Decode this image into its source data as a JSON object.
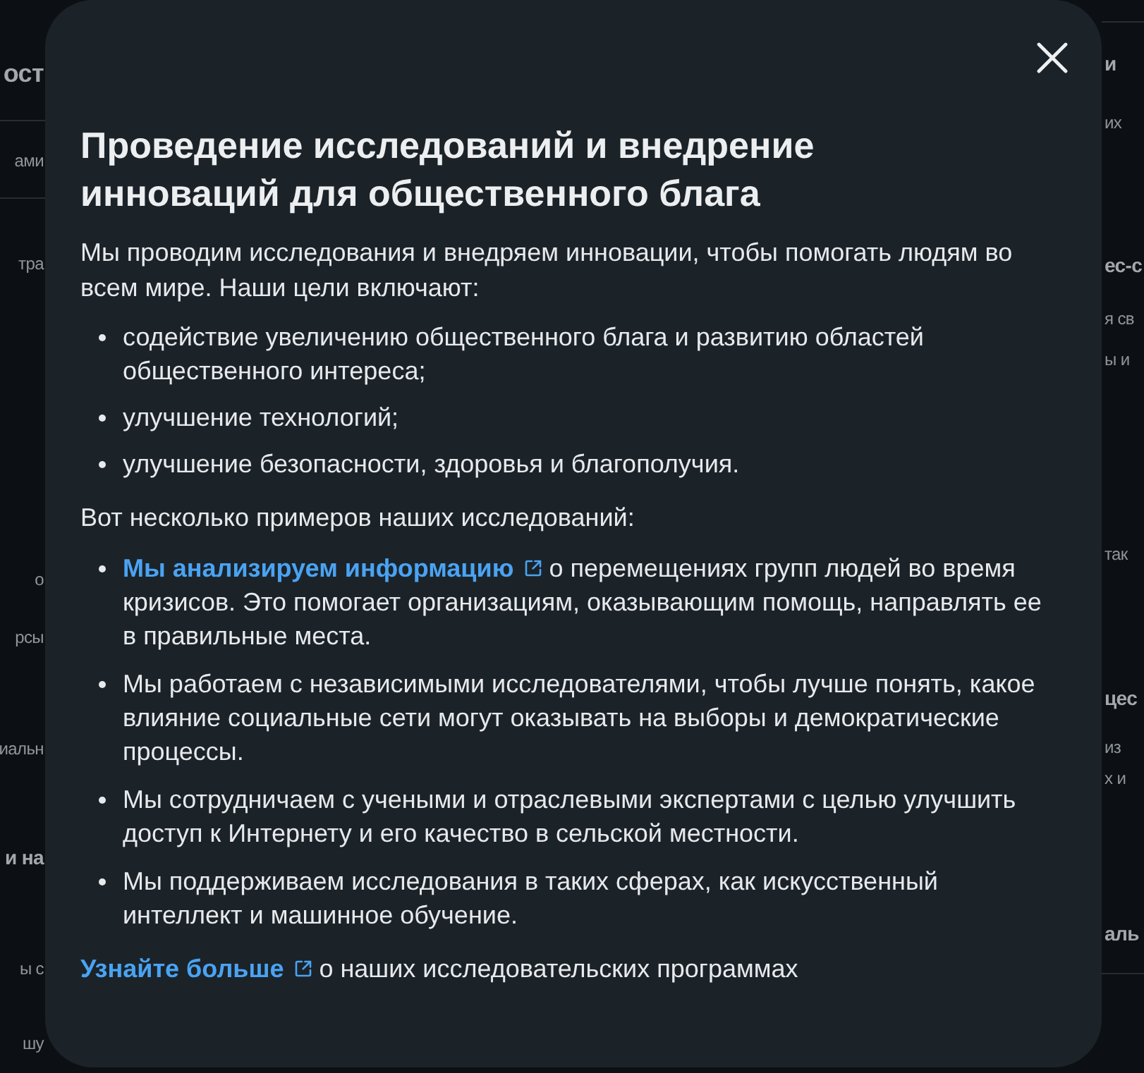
{
  "background": {
    "left_column": [
      {
        "kind": "title",
        "text": "ост"
      },
      {
        "kind": "text",
        "text": "ами"
      },
      {
        "kind": "text",
        "text": "тра"
      },
      {
        "kind": "text",
        "text": "о"
      },
      {
        "kind": "text",
        "text": "рсы"
      },
      {
        "kind": "text",
        "text": "иальн"
      },
      {
        "kind": "heading",
        "text": "и на"
      },
      {
        "kind": "text",
        "text": "ы с"
      },
      {
        "kind": "text",
        "text": "шу"
      }
    ],
    "right_column": [
      {
        "kind": "heading",
        "text": "и"
      },
      {
        "kind": "text",
        "text": "их"
      },
      {
        "kind": "heading",
        "text": "ес-с"
      },
      {
        "kind": "text",
        "text": "я св"
      },
      {
        "kind": "text",
        "text": "ы и"
      },
      {
        "kind": "text",
        "text": "так"
      },
      {
        "kind": "heading",
        "text": "цес"
      },
      {
        "kind": "text",
        "text": "из"
      },
      {
        "kind": "text",
        "text": "х и"
      },
      {
        "kind": "heading",
        "text": "аль"
      }
    ]
  },
  "dialog": {
    "title": "Проведение исследований и внедрение инноваций для общественного блага",
    "intro": "Мы проводим исследования и внедряем инновации, чтобы помогать людям во всем мире. Наши цели включают:",
    "goals": [
      "содействие увеличению общественного блага и развитию областей общественного интереса;",
      "улучшение технологий;",
      "улучшение безопасности, здоровья и благополучия."
    ],
    "examples_intro": "Вот несколько примеров наших исследований:",
    "examples": [
      {
        "link": "Мы анализируем информацию",
        "text": "о перемещениях групп людей во время кризисов. Это помогает организациям, оказывающим помощь, направлять ее в правильные места."
      },
      {
        "text": "Мы работаем с независимыми исследователями, чтобы лучше понять, какое влияние социальные сети могут оказывать на выборы и демократические процессы."
      },
      {
        "text": "Мы сотрудничаем с учеными и отраслевыми экспертами с целью улучшить доступ к Интернету и его качество в сельской местности."
      },
      {
        "text": "Мы поддерживаем исследования в таких сферах, как искусственный интеллект и машинное обучение."
      }
    ],
    "footer": {
      "link": "Узнайте больше",
      "text": "о наших исследовательских программах"
    }
  }
}
